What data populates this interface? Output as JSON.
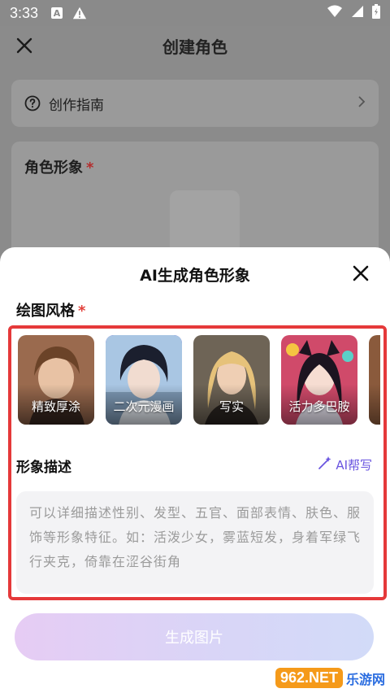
{
  "status_bar": {
    "time": "3:33",
    "icons": [
      "a-box-icon",
      "warning-icon",
      "wifi-icon",
      "signal-icon",
      "battery-icon"
    ]
  },
  "page": {
    "title": "创建角色",
    "guide_label": "创作指南",
    "role_image_label": "角色形象",
    "required_mark": "*"
  },
  "sheet": {
    "title": "AI生成角色形象",
    "style_label": "绘图风格",
    "required_mark": "*",
    "styles": [
      {
        "label": "精致厚涂",
        "selected": false
      },
      {
        "label": "二次元漫画",
        "selected": true
      },
      {
        "label": "写实",
        "selected": false
      },
      {
        "label": "活力多巴胺",
        "selected": false
      },
      {
        "label": "纟",
        "selected": false
      }
    ],
    "desc_label": "形象描述",
    "ai_write": "AI帮写",
    "desc_placeholder": "可以详细描述性别、发型、五官、面部表情、肤色、服饰等形象特征。如：活泼少女，雾蓝短发，身着军绿飞行夹克，倚靠在涩谷街角",
    "generate_button": "生成图片"
  },
  "watermark": {
    "brand": "962.NET",
    "sub": "乐游网"
  },
  "colors": {
    "accent": "#6a55e0",
    "highlight_border": "#e5393a",
    "required": "#e2413b"
  }
}
